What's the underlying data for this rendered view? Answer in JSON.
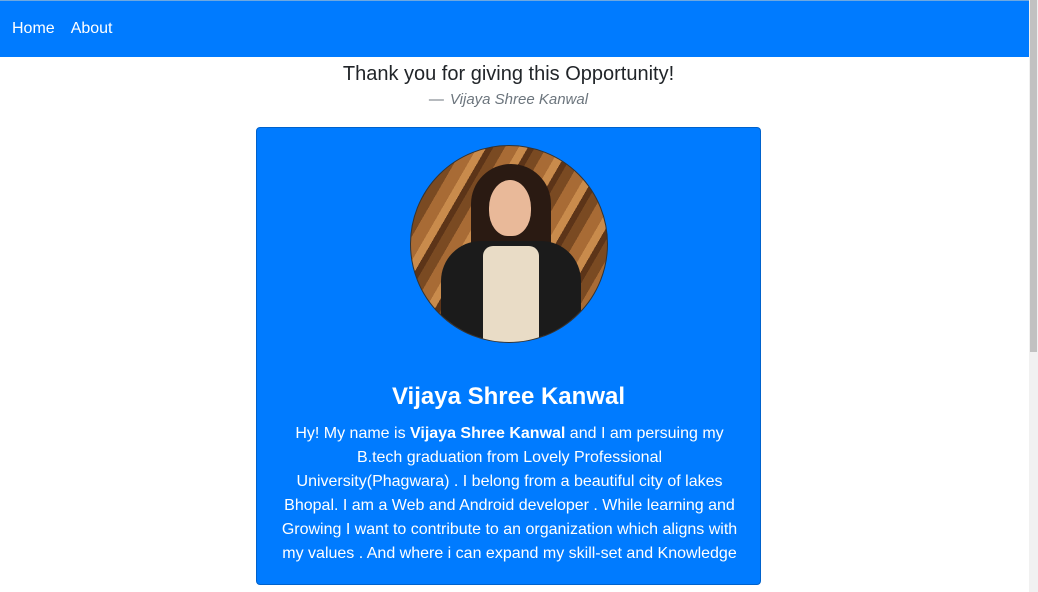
{
  "navbar": {
    "links": [
      "Home",
      "About"
    ],
    "background": "#007bff"
  },
  "quote": {
    "text": "Thank you for giving this Opportunity!",
    "dash": "—",
    "author": "Vijaya Shree Kanwal"
  },
  "card": {
    "background": "#007bff",
    "avatar_alt": "profile photo",
    "title": "Vijaya Shree Kanwal",
    "bio_before": "Hy! My name is ",
    "bio_name": "Vijaya Shree Kanwal",
    "bio_after": " and I am persuing my B.tech graduation from Lovely Professional University(Phagwara) . I belong from a beautiful city of lakes Bhopal. I am a Web and Android developer . While learning and Growing I want to contribute to an organization which aligns with my values . And where i can expand my skill-set and Knowledge"
  }
}
